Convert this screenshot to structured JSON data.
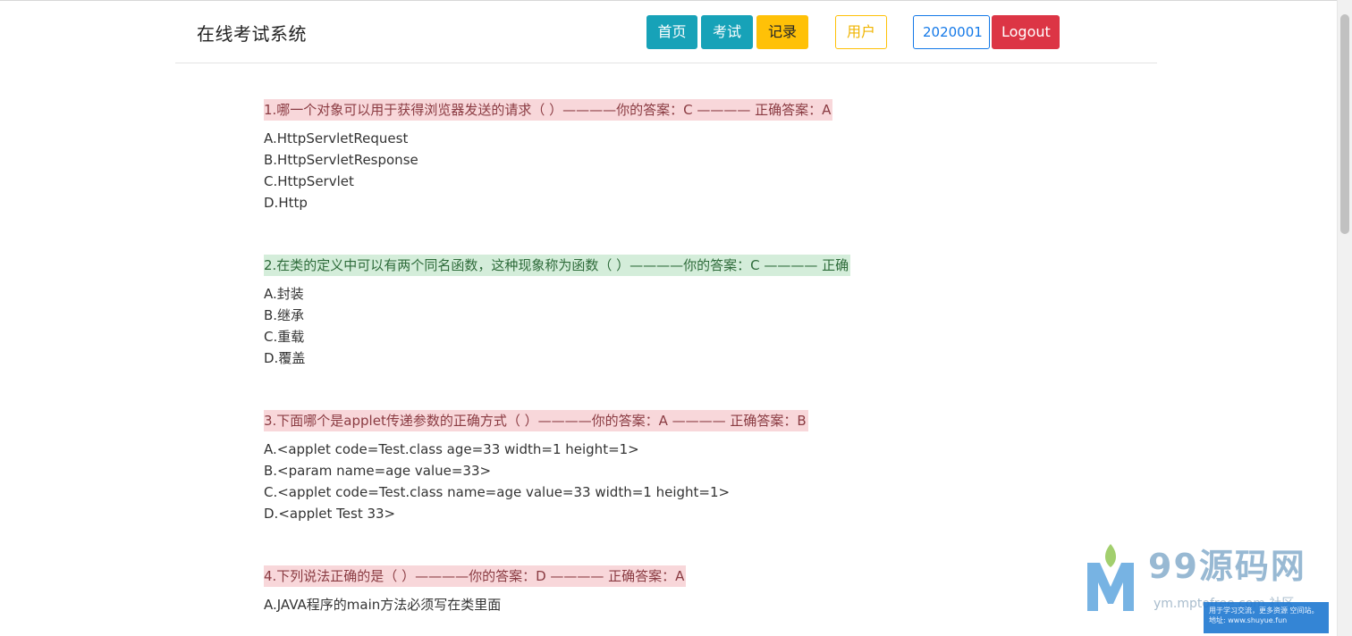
{
  "header": {
    "title": "在线考试系统",
    "buttons": {
      "home": "首页",
      "exam": "考试",
      "record": "记录",
      "user": "用户",
      "user_id": "2020001",
      "logout": "Logout"
    }
  },
  "questions": [
    {
      "title": "1.哪一个对象可以用于获得浏览器发送的请求（ ）————你的答案：C ———— 正确答案：A",
      "status": "wrong",
      "options": [
        "A.HttpServletRequest",
        "B.HttpServletResponse",
        "C.HttpServlet",
        "D.Http"
      ]
    },
    {
      "title": "2.在类的定义中可以有两个同名函数，这种现象称为函数（ ）————你的答案：C ———— 正确",
      "status": "correct",
      "options": [
        "A.封装",
        "B.继承",
        "C.重载",
        "D.覆盖"
      ]
    },
    {
      "title": "3.下面哪个是applet传递参数的正确方式（ ）————你的答案：A ———— 正确答案：B",
      "status": "wrong",
      "options": [
        "A.<applet code=Test.class age=33 width=1 height=1>",
        "B.<param name=age value=33>",
        "C.<applet code=Test.class name=age value=33 width=1 height=1>",
        "D.<applet Test 33>"
      ]
    },
    {
      "title": "4.下列说法正确的是（ ）————你的答案：D ———— 正确答案：A",
      "status": "wrong",
      "options": [
        "A.JAVA程序的main方法必须写在类里面"
      ]
    }
  ],
  "watermark": {
    "brand": "99源码网",
    "url": "ym.mptofree.com 社区",
    "tip": "用于学习交流，更多资源 空间站。地址: www.shuyue.fun"
  }
}
